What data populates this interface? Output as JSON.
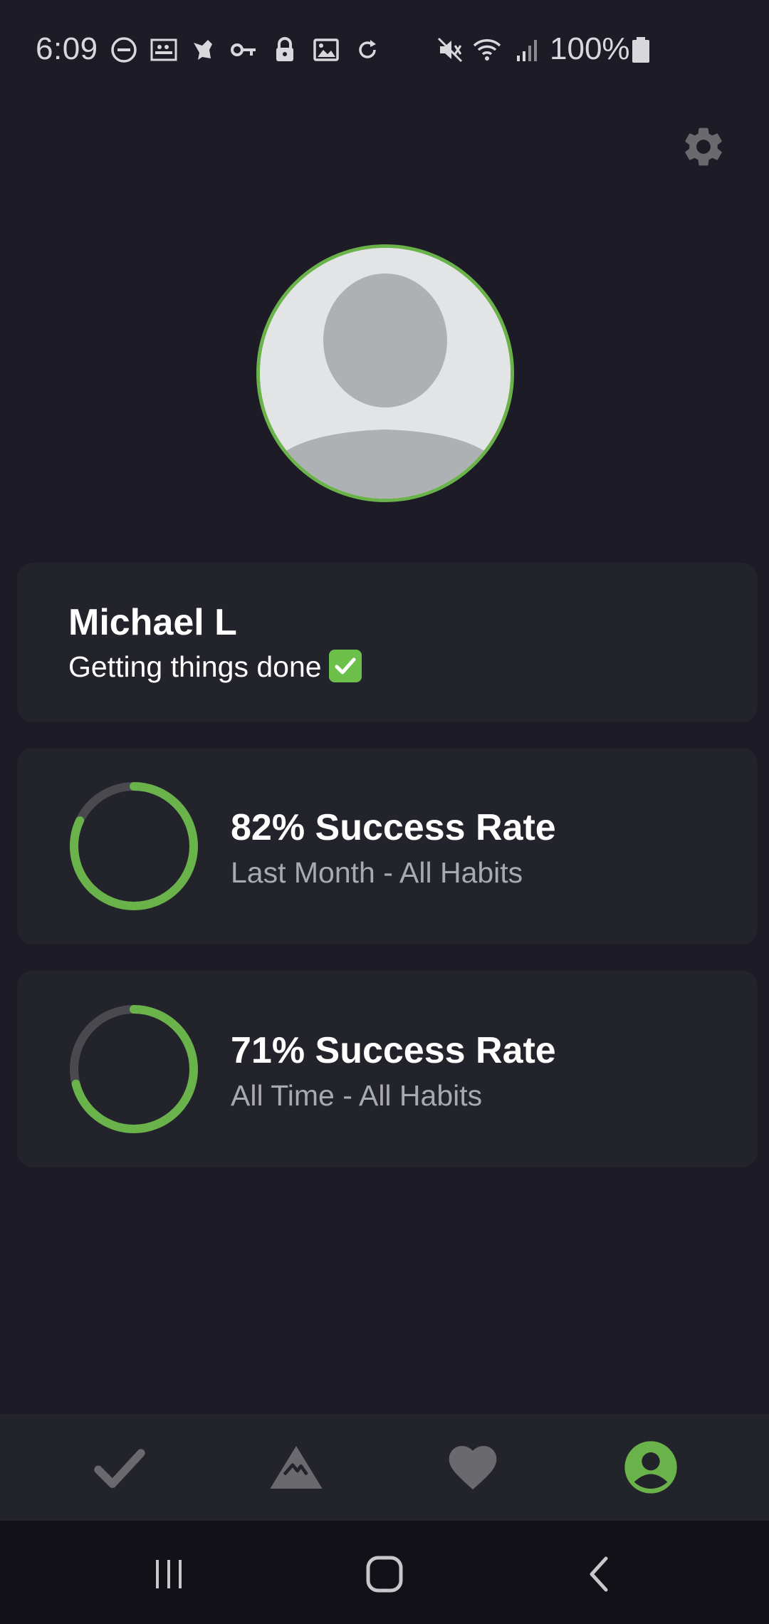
{
  "status_bar": {
    "time": "6:09",
    "battery_text": "100%",
    "icons": [
      "do-not-disturb-icon",
      "caption-icon",
      "bird-icon",
      "key-icon",
      "lock-icon",
      "image-icon",
      "sync-icon",
      "mute-icon",
      "wifi-icon",
      "signal-icon",
      "battery-icon"
    ]
  },
  "settings": {
    "icon": "gear-icon"
  },
  "profile": {
    "name": "Michael L",
    "status": "Getting things done",
    "status_emoji": "check-mark-button-icon"
  },
  "stats": [
    {
      "title": "82% Success Rate",
      "subtitle": "Last Month - All Habits",
      "progress": 0.82
    },
    {
      "title": "71% Success Rate",
      "subtitle": "All Time - All Habits",
      "progress": 0.71
    }
  ],
  "bottom_nav": {
    "items": [
      {
        "icon": "check-icon",
        "active": false
      },
      {
        "icon": "mountain-icon",
        "active": false
      },
      {
        "icon": "heart-icon",
        "active": false
      },
      {
        "icon": "account-icon",
        "active": true
      }
    ]
  },
  "system_nav": {
    "items": [
      "recent-apps-icon",
      "home-icon",
      "back-icon"
    ]
  },
  "colors": {
    "background": "#1d1c26",
    "card": "#23232b",
    "accent": "#6ab24a",
    "ring_track": "#4a4a4e",
    "inactive_icon": "#6a6a6e",
    "secondary_text": "#a9a9b0"
  }
}
